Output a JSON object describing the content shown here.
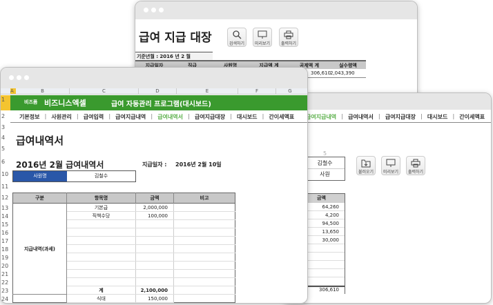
{
  "back_window": {
    "title": "급여 지급 대장",
    "buttons": [
      "검색하기",
      "미리보기",
      "출력하기"
    ],
    "base_month": "기준년월 : 2016 년  2 월",
    "headers": [
      "지급일자",
      "직급",
      "사원명",
      "지급액 계",
      "공제액 계",
      "실수령액"
    ],
    "row": [
      "",
      "",
      "",
      "",
      "306,610",
      "2,043,390"
    ]
  },
  "mid_window": {
    "nav": [
      "급여지급내역",
      "급여내역서",
      "급여지급대장",
      "대시보드",
      "간이세액표"
    ],
    "col_label": "5",
    "employee": [
      "김철수",
      "사원"
    ],
    "buttons": [
      "불러오기",
      "미리보기",
      "출력하기"
    ],
    "amount_header": "금액",
    "amounts": [
      "64,260",
      "4,200",
      "94,500",
      "13,650",
      "30,000",
      "",
      "",
      "",
      "",
      ""
    ],
    "total": "306,610"
  },
  "front_window": {
    "columns": [
      "A",
      "B",
      "C",
      "D",
      "E",
      "F",
      "G"
    ],
    "brand_small": "비즈폼",
    "brand": "비즈니스엑셀",
    "program_title": "급여 자동관리 프로그램(대시보드)",
    "nav": [
      "기본정보",
      "사원관리",
      "급여입력",
      "급여지급내역",
      "급여내역서",
      "급여지급대장",
      "대시보드",
      "간이세액표"
    ],
    "active_nav": "급여내역서",
    "page_title": "급여내역서",
    "subtitle": "2016년 2월  급여내역서",
    "pay_date_label": "지급일자 :",
    "pay_date": "2016년 2월 10일",
    "employee_label": "사원명",
    "employee_name": "김철수",
    "row_numbers": [
      "1",
      "2",
      "3",
      "4",
      "5",
      "6",
      "10",
      "11",
      "12",
      "13",
      "14",
      "15",
      "16",
      "17",
      "18",
      "19",
      "20",
      "21",
      "22",
      "23",
      "24"
    ],
    "table": {
      "headers": [
        "구분",
        "항목명",
        "금액",
        "비고"
      ],
      "category": "지급내역(과세)",
      "rows": [
        [
          "기본급",
          "2,000,000"
        ],
        [
          "직책수당",
          "100,000"
        ],
        [
          "",
          ""
        ],
        [
          "",
          ""
        ],
        [
          "",
          ""
        ],
        [
          "",
          ""
        ],
        [
          "",
          ""
        ],
        [
          "",
          ""
        ],
        [
          "",
          ""
        ],
        [
          "",
          ""
        ]
      ],
      "total": [
        "계",
        "2,100,000"
      ],
      "next": [
        "식대",
        "150,000"
      ]
    },
    "accent": "#3a9a2e"
  }
}
